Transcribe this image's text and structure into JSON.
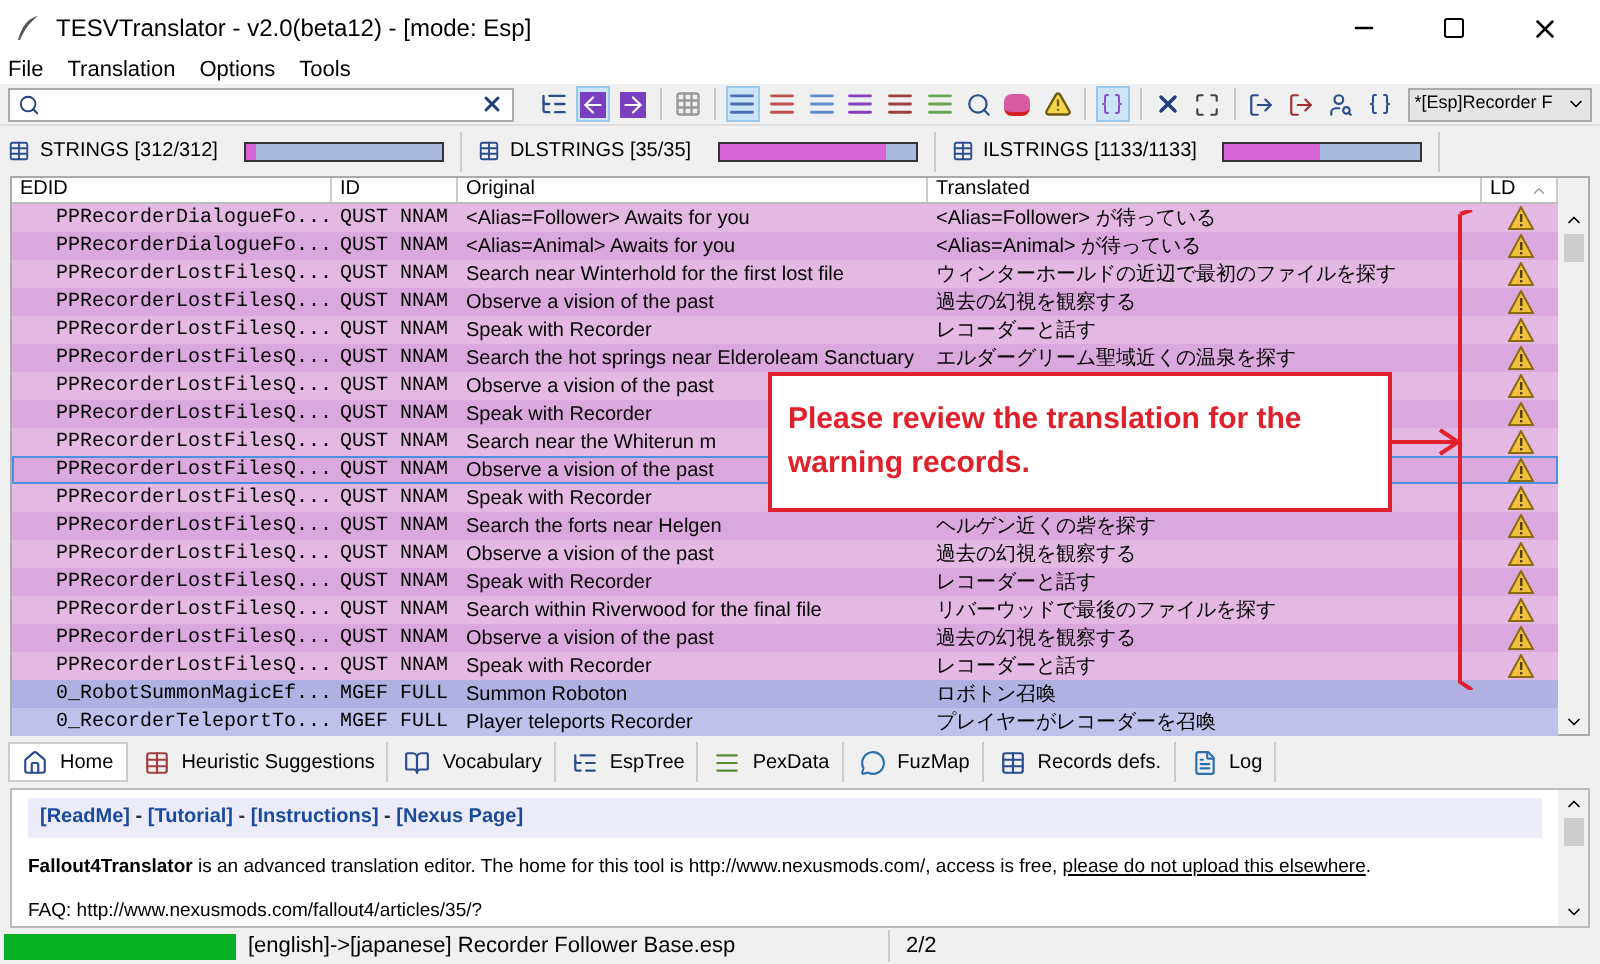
{
  "window": {
    "title": "TESVTranslator - v2.0(beta12) - [mode: Esp]"
  },
  "menu": [
    {
      "label": "File"
    },
    {
      "label": "Translation"
    },
    {
      "label": "Options"
    },
    {
      "label": "Tools"
    }
  ],
  "toolbar": {
    "buttons": [
      {
        "kind": "tree",
        "pressed": false
      },
      {
        "kind": "prev",
        "pressed": true
      },
      {
        "kind": "next",
        "pressed": false
      },
      {
        "kind": "separator"
      },
      {
        "kind": "grid",
        "pressed": false
      },
      {
        "kind": "separator"
      },
      {
        "kind": "list-blue",
        "pressed": true
      },
      {
        "kind": "list-red",
        "pressed": false
      },
      {
        "kind": "list-lightblue",
        "pressed": false
      },
      {
        "kind": "list-purple",
        "pressed": false
      },
      {
        "kind": "list-mixed",
        "pressed": false
      },
      {
        "kind": "list-green",
        "pressed": false
      },
      {
        "kind": "search",
        "pressed": false
      },
      {
        "kind": "spell",
        "pressed": false
      },
      {
        "kind": "warning",
        "pressed": false
      },
      {
        "kind": "separator"
      },
      {
        "kind": "brackets",
        "pressed": true
      },
      {
        "kind": "separator"
      },
      {
        "kind": "clear",
        "pressed": false
      },
      {
        "kind": "fullscreen",
        "pressed": false
      },
      {
        "kind": "separator"
      },
      {
        "kind": "export",
        "pressed": false
      },
      {
        "kind": "export-red",
        "pressed": false
      },
      {
        "kind": "find-user",
        "pressed": false
      },
      {
        "kind": "code",
        "pressed": false
      }
    ],
    "dropdown": "*[Esp]Recorder F"
  },
  "string_files": [
    {
      "label": "STRINGS [312/312]",
      "level": 0.05
    },
    {
      "label": "DLSTRINGS [35/35]",
      "level": 0.85
    },
    {
      "label": "ILSTRINGS [1133/1133]",
      "level": 0.49
    }
  ],
  "table": {
    "columns": [
      "EDID",
      "ID",
      "Original",
      "Translated",
      "LD"
    ],
    "rows": [
      {
        "edid": "PPRecorderDialogueFo...",
        "id": "QUST NNAM",
        "original": "<Alias=Follower> Awaits for you",
        "translated": "<Alias=Follower> が待っている",
        "warning": true,
        "selected": false,
        "color": "#e3b8e3"
      },
      {
        "edid": "PPRecorderDialogueFo...",
        "id": "QUST NNAM",
        "original": "<Alias=Animal> Awaits for you",
        "translated": "<Alias=Animal> が待っている",
        "warning": true,
        "selected": false,
        "color": "#daa8dc"
      },
      {
        "edid": "PPRecorderLostFilesQ...",
        "id": "QUST NNAM",
        "original": "Search near Winterhold for the first lost file",
        "translated": "ウィンターホールドの近辺で最初のファイルを探す",
        "warning": true,
        "selected": false,
        "color": "#e3b8e3"
      },
      {
        "edid": "PPRecorderLostFilesQ...",
        "id": "QUST NNAM",
        "original": "Observe a vision of the past",
        "translated": "過去の幻視を観察する",
        "warning": true,
        "selected": false,
        "color": "#daa8dc"
      },
      {
        "edid": "PPRecorderLostFilesQ...",
        "id": "QUST NNAM",
        "original": "Speak with Recorder",
        "translated": "レコーダーと話す",
        "warning": true,
        "selected": false,
        "color": "#e3b8e3"
      },
      {
        "edid": "PPRecorderLostFilesQ...",
        "id": "QUST NNAM",
        "original": "Search the hot springs near Elderoleam Sanctuary",
        "translated": "エルダーグリーム聖域近くの温泉を探す",
        "warning": true,
        "selected": false,
        "color": "#daa8dc"
      },
      {
        "edid": "PPRecorderLostFilesQ...",
        "id": "QUST NNAM",
        "original": "Observe a vision of the past",
        "warning": true,
        "selected": false,
        "color": "#e3b8e3"
      },
      {
        "edid": "PPRecorderLostFilesQ...",
        "id": "QUST NNAM",
        "original": "Speak with Recorder",
        "warning": true,
        "selected": false,
        "color": "#daa8dc"
      },
      {
        "edid": "PPRecorderLostFilesQ...",
        "id": "QUST NNAM",
        "original": "Search near the Whiterun m",
        "warning": true,
        "selected": false,
        "color": "#e3b8e3"
      },
      {
        "edid": "PPRecorderLostFilesQ...",
        "id": "QUST NNAM",
        "original": "Observe a vision of the past",
        "warning": true,
        "selected": true,
        "color": "#daa8dc"
      },
      {
        "edid": "PPRecorderLostFilesQ...",
        "id": "QUST NNAM",
        "original": "Speak with Recorder",
        "warning": true,
        "selected": false,
        "color": "#e3b8e3"
      },
      {
        "edid": "PPRecorderLostFilesQ...",
        "id": "QUST NNAM",
        "original": "Search the forts near Helgen",
        "translated": "ヘルゲン近くの砦を探す",
        "warning": true,
        "selected": false,
        "color": "#daa8dc"
      },
      {
        "edid": "PPRecorderLostFilesQ...",
        "id": "QUST NNAM",
        "original": "Observe a vision of the past",
        "translated": "過去の幻視を観察する",
        "warning": true,
        "selected": false,
        "color": "#e3b8e3"
      },
      {
        "edid": "PPRecorderLostFilesQ...",
        "id": "QUST NNAM",
        "original": "Speak with Recorder",
        "translated": "レコーダーと話す",
        "warning": true,
        "selected": false,
        "color": "#daa8dc"
      },
      {
        "edid": "PPRecorderLostFilesQ...",
        "id": "QUST NNAM",
        "original": "Search within Riverwood for the final file",
        "translated": "リバーウッドで最後のファイルを探す",
        "warning": true,
        "selected": false,
        "color": "#e3b8e3"
      },
      {
        "edid": "PPRecorderLostFilesQ...",
        "id": "QUST NNAM",
        "original": "Observe a vision of the past",
        "translated": "過去の幻視を観察する",
        "warning": true,
        "selected": false,
        "color": "#daa8dc"
      },
      {
        "edid": "PPRecorderLostFilesQ...",
        "id": "QUST NNAM",
        "original": "Speak with Recorder",
        "translated": "レコーダーと話す",
        "warning": true,
        "selected": false,
        "color": "#e3b8e3"
      },
      {
        "edid": "0_RobotSummonMagicEf...",
        "id": "MGEF FULL",
        "original": "Summon Roboton",
        "translated": "ロボトン召喚",
        "warning": false,
        "selected": false,
        "color": "#b0b0e2"
      },
      {
        "edid": "0_RecorderTeleportTo...",
        "id": "MGEF FULL",
        "original": "Player teleports Recorder",
        "translated": "プレイヤーがレコーダーを召喚",
        "warning": false,
        "selected": false,
        "color": "#c0c0ec"
      }
    ]
  },
  "annotation": {
    "text": "Please review the translation for the warning records."
  },
  "bottom_tabs": [
    {
      "label": "Home",
      "kind": "home",
      "selected": true
    },
    {
      "label": "Heuristic Suggestions",
      "kind": "heuristic",
      "selected": false
    },
    {
      "label": "Vocabulary",
      "kind": "vocabulary",
      "selected": false
    },
    {
      "label": "EspTree",
      "kind": "tree",
      "selected": false
    },
    {
      "label": "PexData",
      "kind": "pex",
      "selected": false
    },
    {
      "label": "FuzMap",
      "kind": "fuzmap",
      "selected": false
    },
    {
      "label": "Records defs.",
      "kind": "records",
      "selected": false
    },
    {
      "label": "Log",
      "kind": "log",
      "selected": false
    }
  ],
  "home": {
    "links": [
      "[ReadMe]",
      " - ",
      "[Tutorial]",
      " - ",
      "[Instructions]",
      " - ",
      "[Nexus Page]"
    ],
    "intro": "**Fallout4Translator** is an advanced translation editor. The home for this tool is http://www.nexusmods.com/, access is free, ",
    "intro_link": "please do not upload this elsewhere",
    "intro_end": ".",
    "faq": "FAQ: http://www.nexusmods.com/fallout4/articles/35/?"
  },
  "status_bar": {
    "level": 1,
    "file": "[english]->[japanese] Recorder Follower Base.esp",
    "count": "2/2"
  }
}
